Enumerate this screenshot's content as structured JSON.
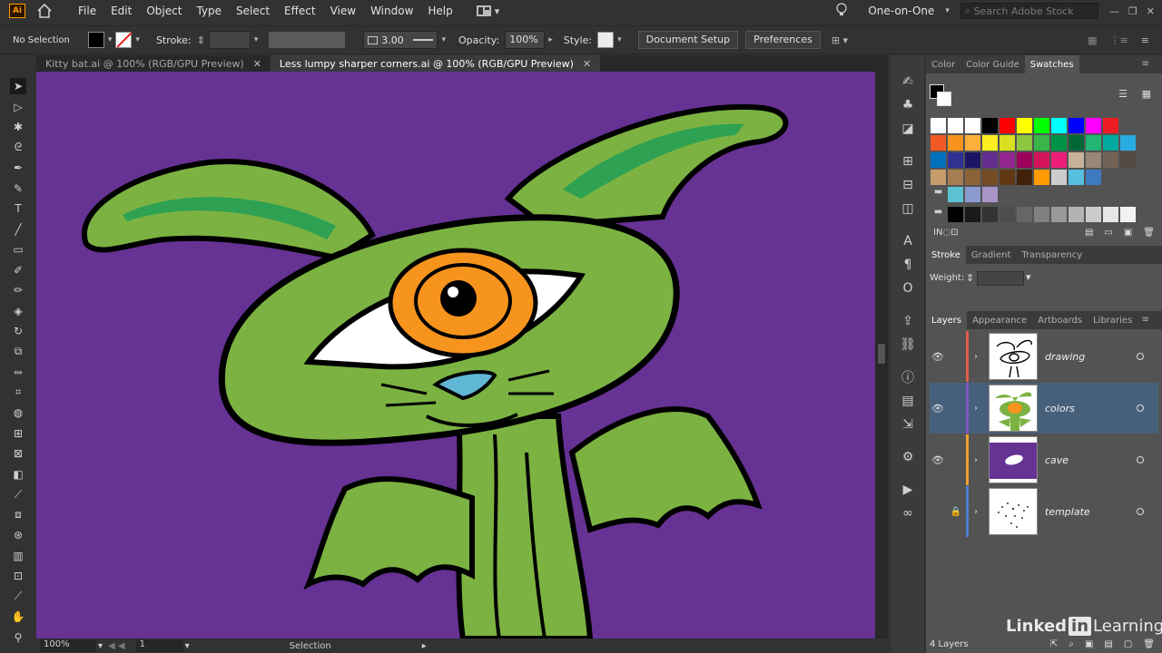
{
  "app": {
    "logo": "Ai"
  },
  "menu": [
    "File",
    "Edit",
    "Object",
    "Type",
    "Select",
    "Effect",
    "View",
    "Window",
    "Help"
  ],
  "header": {
    "workspace": "One-on-One",
    "search_placeholder": "Search Adobe Stock"
  },
  "control": {
    "selection": "No Selection",
    "stroke_label": "Stroke:",
    "brush_size": "3.00",
    "opacity_label": "Opacity:",
    "opacity_value": "100%",
    "style_label": "Style:",
    "doc_setup": "Document Setup",
    "preferences": "Preferences"
  },
  "tabs": [
    {
      "label": "Kitty bat.ai @ 100% (RGB/GPU Preview)",
      "active": false
    },
    {
      "label": "Less lumpy sharper corners.ai @ 100% (RGB/GPU Preview)",
      "active": true
    }
  ],
  "status": {
    "zoom": "100%",
    "artboard": "1",
    "tool": "Selection"
  },
  "panels": {
    "color_tabs": [
      "Color",
      "Color Guide",
      "Swatches"
    ],
    "active_color_tab": "Swatches",
    "stroke_tabs": [
      "Stroke",
      "Gradient",
      "Transparency"
    ],
    "weight_label": "Weight:",
    "layer_tabs": [
      "Layers",
      "Appearance",
      "Artboards",
      "Libraries"
    ],
    "layers_count": "4 Layers"
  },
  "layers": [
    {
      "name": "drawing",
      "color": "#e0604a",
      "visible": true,
      "locked": false,
      "selected": false
    },
    {
      "name": "colors",
      "color": "#7e57c2",
      "visible": true,
      "locked": false,
      "selected": true
    },
    {
      "name": "cave",
      "color": "#f0a030",
      "visible": true,
      "locked": false,
      "selected": false
    },
    {
      "name": "template",
      "color": "#4a7fd4",
      "visible": false,
      "locked": true,
      "selected": false
    }
  ],
  "swatches": {
    "row1": [
      "#ffffff",
      "#000000",
      "#ff0000",
      "#ffff00",
      "#00ff00",
      "#00ffff",
      "#0000ff",
      "#ff00ff",
      "#ed1c24"
    ],
    "row2": [
      "#f15a24",
      "#f7931e",
      "#fbb03b",
      "#fcee21",
      "#d9e021",
      "#8cc63f",
      "#39b54a",
      "#009245",
      "#006837",
      "#22b573",
      "#00a99d",
      "#29abe2"
    ],
    "row3": [
      "#0071bc",
      "#2e3192",
      "#1b1464",
      "#662d91",
      "#93278f",
      "#9e005d",
      "#d4145a",
      "#ed1e79",
      "#c7b299",
      "#998675",
      "#736357",
      "#534741"
    ],
    "row4": [
      "#c69c6d",
      "#a67c52",
      "#8c6239",
      "#754c24",
      "#603813",
      "#42210b",
      "#ff9a00",
      "#cccccc",
      "#55c0e0",
      "#3d7ac0"
    ],
    "row5": [
      "#5bc2d3",
      "#8b9bd1",
      "#a994c8"
    ],
    "row6": [
      "#000000",
      "#1a1a1a",
      "#333333",
      "#4d4d4d",
      "#666666",
      "#808080",
      "#999999",
      "#b3b3b3",
      "#cccccc",
      "#e6e6e6",
      "#f2f2f2"
    ]
  },
  "colors": {
    "canvas_bg": "#663294",
    "selection": "#46607c",
    "accent": "#ff9a00"
  },
  "watermark": {
    "linked": "Linked",
    "in": "in",
    "learning": "Learning"
  }
}
